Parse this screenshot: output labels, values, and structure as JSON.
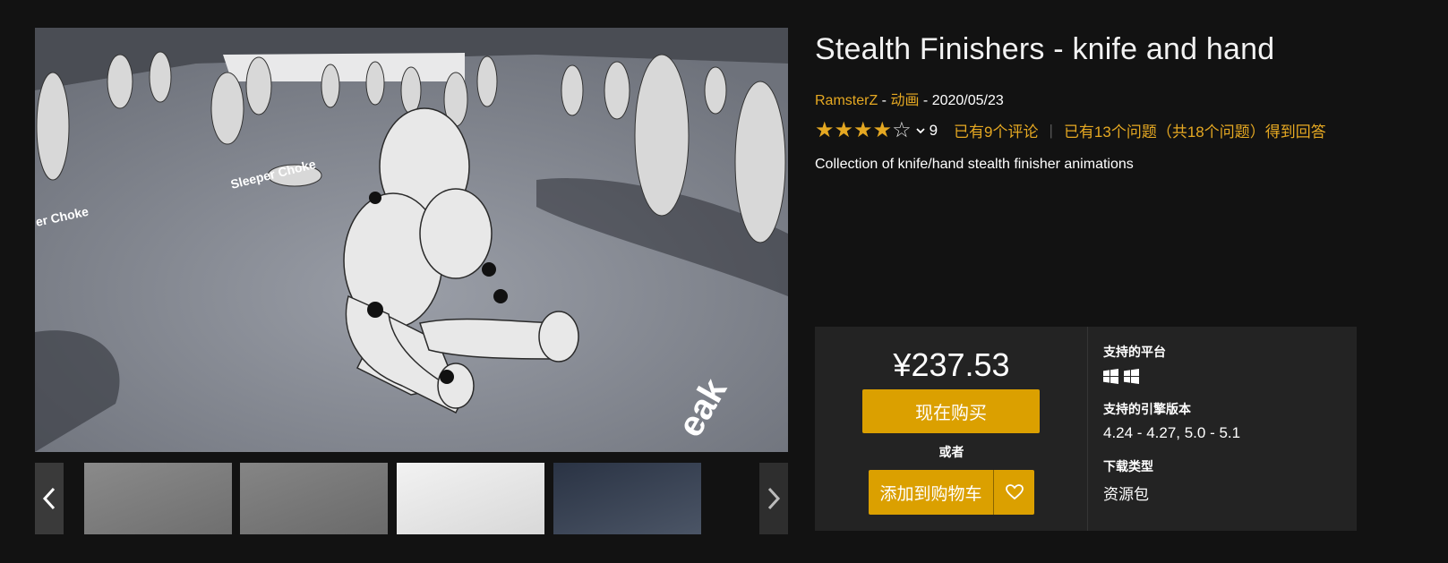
{
  "product": {
    "title": "Stealth Finishers - knife and hand",
    "author": "RamsterZ",
    "category": "动画",
    "date": "2020/05/23",
    "sep1": " - ",
    "sep2": " - ",
    "rating_stars": 4,
    "rating_count": "9",
    "reviews_link": "已有9个评论",
    "questions_link": "已有13个问题（共18个问题）得到回答",
    "description": "Collection of knife/hand stealth finisher animations"
  },
  "hero": {
    "scene_labels": [
      "Sleeper Choke",
      "er Choke",
      "eak"
    ]
  },
  "purchase": {
    "price": "¥237.53",
    "buy_now": "现在购买",
    "or": "或者",
    "add_to_cart": "添加到购物车"
  },
  "specs": {
    "platforms_label": "支持的平台",
    "platform_icons": [
      "windows-icon",
      "windows-icon"
    ],
    "engine_label": "支持的引擎版本",
    "engine_value": "4.24 - 4.27, 5.0 - 5.1",
    "download_label": "下载类型",
    "download_value": "资源包"
  },
  "colors": {
    "accent": "#dba000",
    "link": "#e5a822",
    "background": "#121212",
    "panel": "#232323"
  }
}
